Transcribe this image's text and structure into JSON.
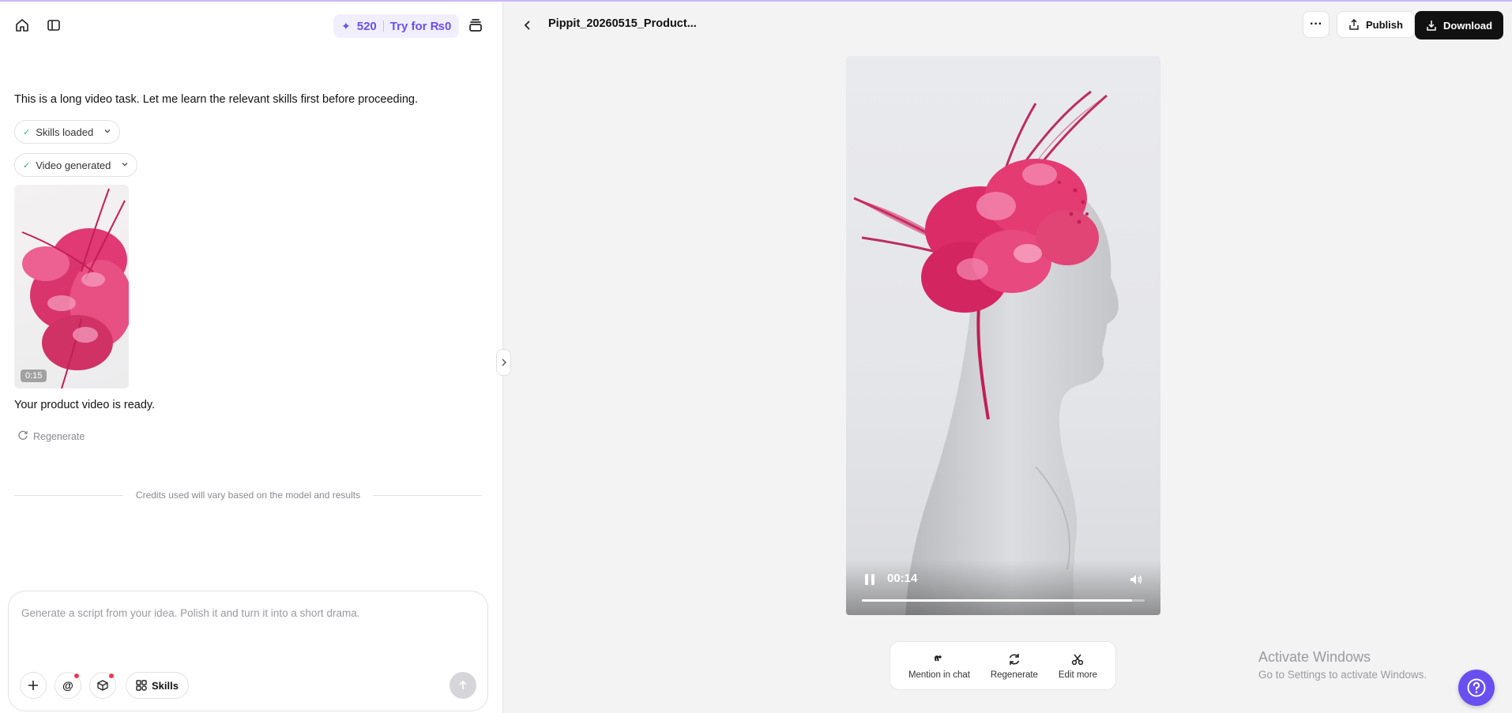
{
  "credits": {
    "amount": "520",
    "try_label": "Try for ₨0"
  },
  "chat": {
    "intro_message": "This is a long video task. Let me learn the relevant skills first before proceeding.",
    "chips": [
      {
        "label": "Skills loaded"
      },
      {
        "label": "Video generated"
      }
    ],
    "video_thumb": {
      "duration": "0:15"
    },
    "ready_message": "Your product video is ready.",
    "regenerate_label": "Regenerate",
    "credits_note": "Credits used will vary based on the model and results"
  },
  "composer": {
    "placeholder": "Generate a script from your idea. Polish it and turn it into a short drama.",
    "skills_label": "Skills"
  },
  "preview": {
    "file_title": "Pippit_20260515_Product...",
    "publish_label": "Publish",
    "download_label": "Download",
    "player": {
      "time": "00:14",
      "progress": 0.955
    },
    "actions": [
      {
        "label": "Mention in chat",
        "icon": "quote-icon"
      },
      {
        "label": "Regenerate",
        "icon": "refresh-icon"
      },
      {
        "label": "Edit more",
        "icon": "scissors-icon"
      }
    ]
  },
  "system": {
    "activate_title": "Activate Windows",
    "activate_sub": "Go to Settings to activate Windows."
  },
  "colors": {
    "accent": "#6a4ff0",
    "fascinator": "#e0306e",
    "dark_button": "#111111"
  }
}
